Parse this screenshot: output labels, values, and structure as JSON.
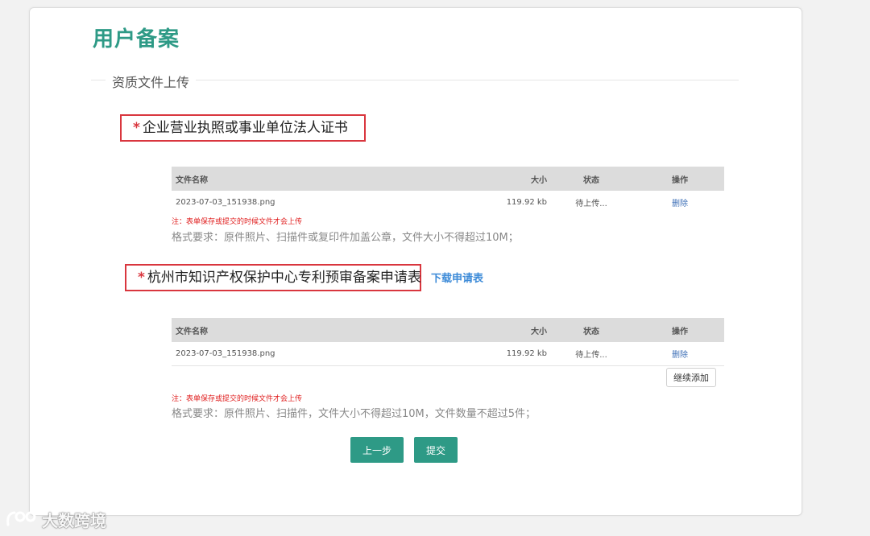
{
  "page": {
    "title": "用户备案",
    "section_title": "资质文件上传"
  },
  "item1": {
    "star": "*",
    "label": "企业营业执照或事业单位法人证书"
  },
  "item2": {
    "star": "*",
    "label": "杭州市知识产权保护中心专利预审备案申请表",
    "download_label": "下载申请表"
  },
  "table": {
    "headers": {
      "name": "文件名称",
      "size": "大小",
      "status": "状态",
      "op": "操作"
    },
    "rows1": [
      {
        "name": "2023-07-03_151938.png",
        "size": "119.92 kb",
        "status": "待上传...",
        "op": "删除"
      }
    ],
    "rows2": [
      {
        "name": "2023-07-03_151938.png",
        "size": "119.92 kb",
        "status": "待上传...",
        "op": "删除"
      }
    ]
  },
  "notes": {
    "upload_note": "注：表单保存或提交的时候文件才会上传",
    "req1": "格式要求：原件照片、扫描件或复印件加盖公章，文件大小不得超过10M；",
    "req2": "格式要求：原件照片、扫描件，文件大小不得超过10M，文件数量不超过5件；"
  },
  "buttons": {
    "add_more": "继续添加",
    "prev": "上一步",
    "submit": "提交"
  },
  "watermark": {
    "text": "大数跨境",
    "icon": "brand-logo-icon"
  },
  "colors": {
    "brand": "#2e9a86",
    "required": "#d9363e",
    "link": "#3d8bd8"
  }
}
